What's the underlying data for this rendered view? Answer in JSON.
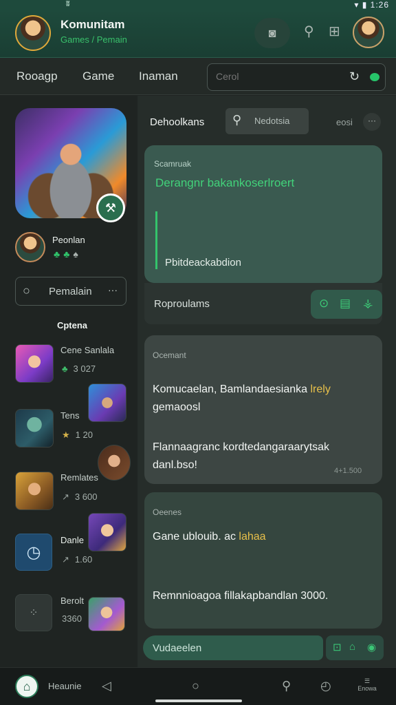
{
  "status_bar": {
    "left_icon": "ʬ",
    "time": "1:26"
  },
  "header": {
    "title": "Komunitam",
    "subtitle": "Games / Pemain",
    "icons": [
      "camera-icon",
      "search-icon",
      "apps-icon"
    ]
  },
  "nav": {
    "tabs": [
      "Rooagp",
      "Game",
      "Inaman"
    ],
    "search_placeholder": "Cerol"
  },
  "sidebar": {
    "player_name": "Peonlan",
    "search_label": "Pemalain",
    "options_label": "Cptena",
    "games": [
      {
        "name": "Cene Sanlala",
        "meta": "3 027"
      },
      {
        "name": "Tens",
        "meta": "1 20"
      },
      {
        "name": "Remlates",
        "meta": "3 600"
      },
      {
        "name": "Danle",
        "meta": "1.60"
      },
      {
        "name": "Berolt",
        "meta": "3360"
      }
    ]
  },
  "main": {
    "title": "Dehoolkans",
    "search_label": "Nedotsia",
    "sort_label": "eosi",
    "more_label": "···",
    "posts": [
      {
        "category": "Scamruak",
        "headline": "Derangnr bakankoserlroert",
        "sub": "Pbitdeackabdion",
        "footer_label": "Roproulams"
      },
      {
        "category": "Ocemant",
        "body_start": "Komucaelan, Bamlandaesianka ",
        "body_highlight": "lrely",
        "body_end": " gemaoosl",
        "body2": "Flannaagranc kordtedangaraarytsak danl.bso!",
        "timestamp": "4+1.500"
      },
      {
        "category": "Oeenes",
        "body_start": "Gane ublouib. ac ",
        "body_highlight": "lahaa",
        "body_end": "",
        "body2": "Remnnioagoa fillakapbandlan 3000."
      }
    ],
    "reply_value": "Vudaeelen"
  },
  "bottom_nav": {
    "home_label": "Heaunie",
    "last_label": "Enowa"
  },
  "colors": {
    "accent_green": "#34c46b",
    "header_bg": "#1e4a3c",
    "highlight_gold": "#e8c04a"
  }
}
